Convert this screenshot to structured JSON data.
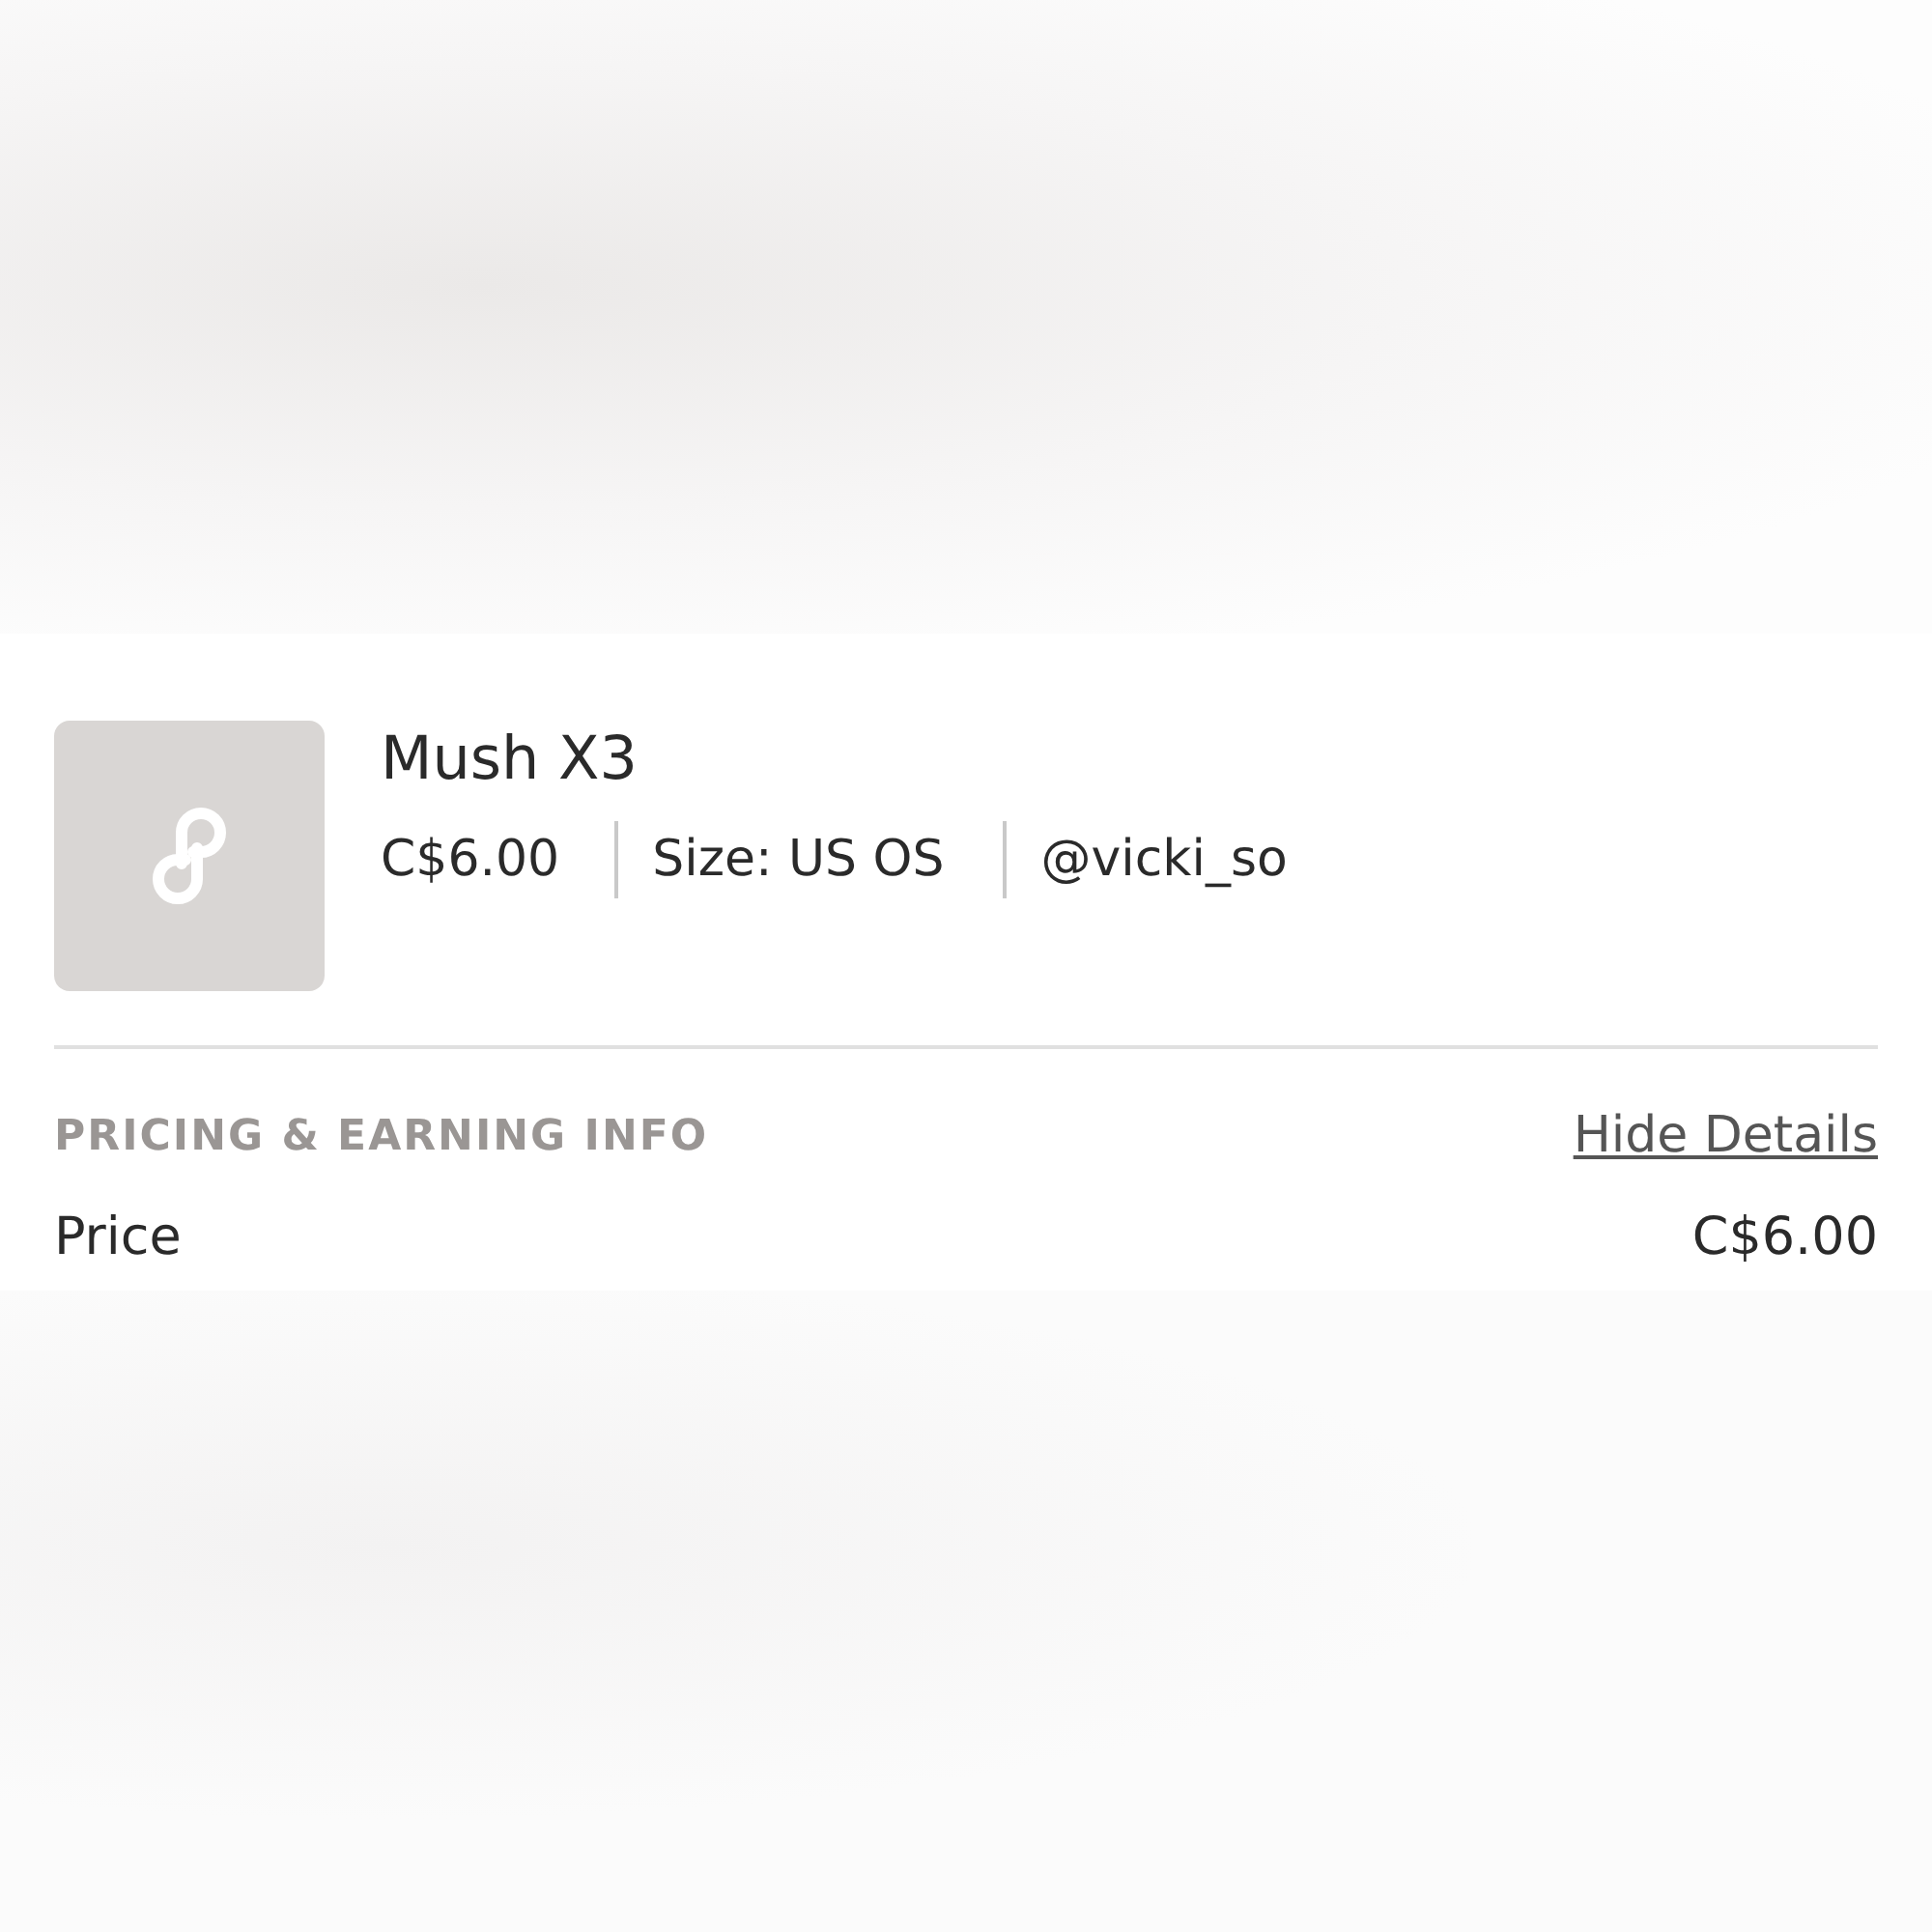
{
  "listing": {
    "title": "Mush X3",
    "price": "C$6.00",
    "size": "Size: US OS",
    "seller": "@vicki_so"
  },
  "pricing": {
    "heading": "PRICING & EARNING INFO",
    "toggle": "Hide Details",
    "rows": [
      {
        "label": "Price",
        "value": "C$6.00"
      }
    ]
  }
}
